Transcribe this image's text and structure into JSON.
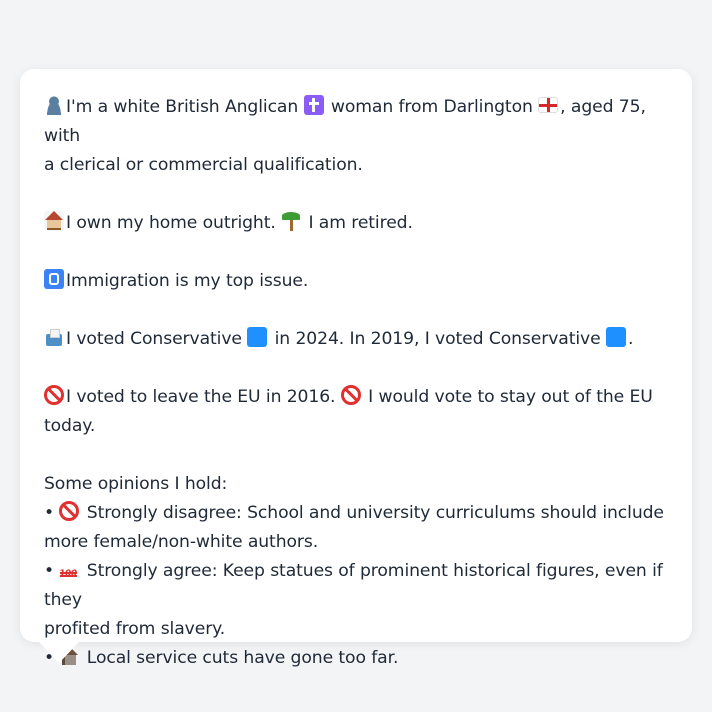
{
  "profile": {
    "identity_1": "I'm a white British Anglican ",
    "identity_2": " woman from Darlington ",
    "identity_3": ", aged 75, with",
    "identity_4": "a clerical or commercial qualification.",
    "housing_1": "I own my home outright. ",
    "housing_2": " I am retired.",
    "issue": "Immigration is my top issue.",
    "vote_1": "I voted Conservative ",
    "vote_2": " in 2024. In 2019, I voted Conservative ",
    "vote_3": ".",
    "eu_1": "I voted to leave the EU in 2016. ",
    "eu_2": " I would vote to stay out of the EU",
    "eu_3": "today.",
    "opinions_heading": "Some opinions I hold:",
    "opinion_1a": "• ",
    "opinion_1b": " Strongly disagree: School and university curriculums should include",
    "opinion_1c": "more female/non-white authors.",
    "opinion_2a": "• ",
    "opinion_2b": " Strongly agree: Keep statues of prominent historical figures, even if they",
    "opinion_2c": "profited from slavery.",
    "opinion_3a": "• ",
    "opinion_3b": " Local service cuts have gone too far."
  },
  "icons": {
    "person": "bust-in-silhouette-icon",
    "religion": "latin-cross-icon",
    "flag": "england-flag-icon",
    "home": "house-icon",
    "retired": "palm-tree-icon",
    "issue": "passport-control-icon",
    "vote": "ballot-box-icon",
    "party": "blue-square-icon",
    "eu": "prohibited-icon",
    "agree": "hundred-points-icon",
    "local": "derelict-house-icon"
  },
  "colors": {
    "background": "#f3f4f6",
    "bubble": "#ffffff",
    "text": "#1f2937",
    "conservative": "#1e90ff",
    "prohibited": "#e03131"
  }
}
